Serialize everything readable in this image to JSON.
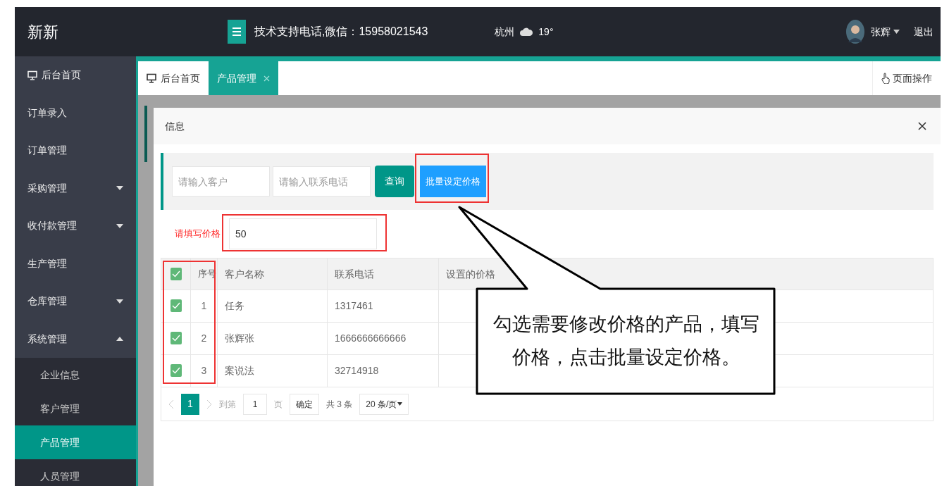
{
  "header": {
    "logo": "新新",
    "support": "技术支持电话,微信：15958021543",
    "city": "杭州",
    "temperature": "19°",
    "user": "张辉",
    "logout": "退出"
  },
  "sidebar": {
    "items": [
      {
        "label": "后台首页",
        "kind": "home",
        "selected": false
      },
      {
        "label": "订单录入",
        "kind": "link",
        "selected": false
      },
      {
        "label": "订单管理",
        "kind": "link",
        "selected": false
      },
      {
        "label": "采购管理",
        "kind": "group",
        "expanded": false,
        "selected": false
      },
      {
        "label": "收付款管理",
        "kind": "group",
        "expanded": false,
        "selected": false
      },
      {
        "label": "生产管理",
        "kind": "link",
        "selected": false
      },
      {
        "label": "仓库管理",
        "kind": "group",
        "expanded": false,
        "selected": false
      },
      {
        "label": "系统管理",
        "kind": "group",
        "expanded": true,
        "selected": false,
        "children": [
          {
            "label": "企业信息",
            "selected": false
          },
          {
            "label": "客户管理",
            "selected": false
          },
          {
            "label": "产品管理",
            "selected": true
          },
          {
            "label": "人员管理",
            "selected": false
          }
        ]
      }
    ]
  },
  "tabs": [
    {
      "label": "后台首页",
      "selected": false,
      "kind": "home"
    },
    {
      "label": "产品管理",
      "selected": true,
      "kind": "closable"
    }
  ],
  "page_actions": "页面操作",
  "modal": {
    "title": "信息",
    "search": {
      "customer_placeholder": "请输入客户",
      "phone_placeholder": "请输入联系电话",
      "query": "查询",
      "batch": "批量设定价格"
    },
    "price": {
      "label": "请填写价格",
      "value": "50"
    },
    "table": {
      "all_checked": true,
      "columns": [
        "序号",
        "客户名称",
        "联系电话",
        "设置的价格"
      ],
      "rows": [
        {
          "checked": true,
          "index": "1",
          "name": "任务",
          "phone": "1317461"
        },
        {
          "checked": true,
          "index": "2",
          "name": "张辉张",
          "phone": "1666666666666"
        },
        {
          "checked": true,
          "index": "3",
          "name": "案说法",
          "phone": "32714918"
        }
      ]
    },
    "pagination": {
      "current": "1",
      "goto": "到第",
      "page_input": "1",
      "page_unit": "页",
      "confirm": "确定",
      "total": "共 3 条",
      "page_size": "20 条/页"
    }
  },
  "callout": "勾选需要修改价格的产品，填写价格，点击批量设定价格。"
}
